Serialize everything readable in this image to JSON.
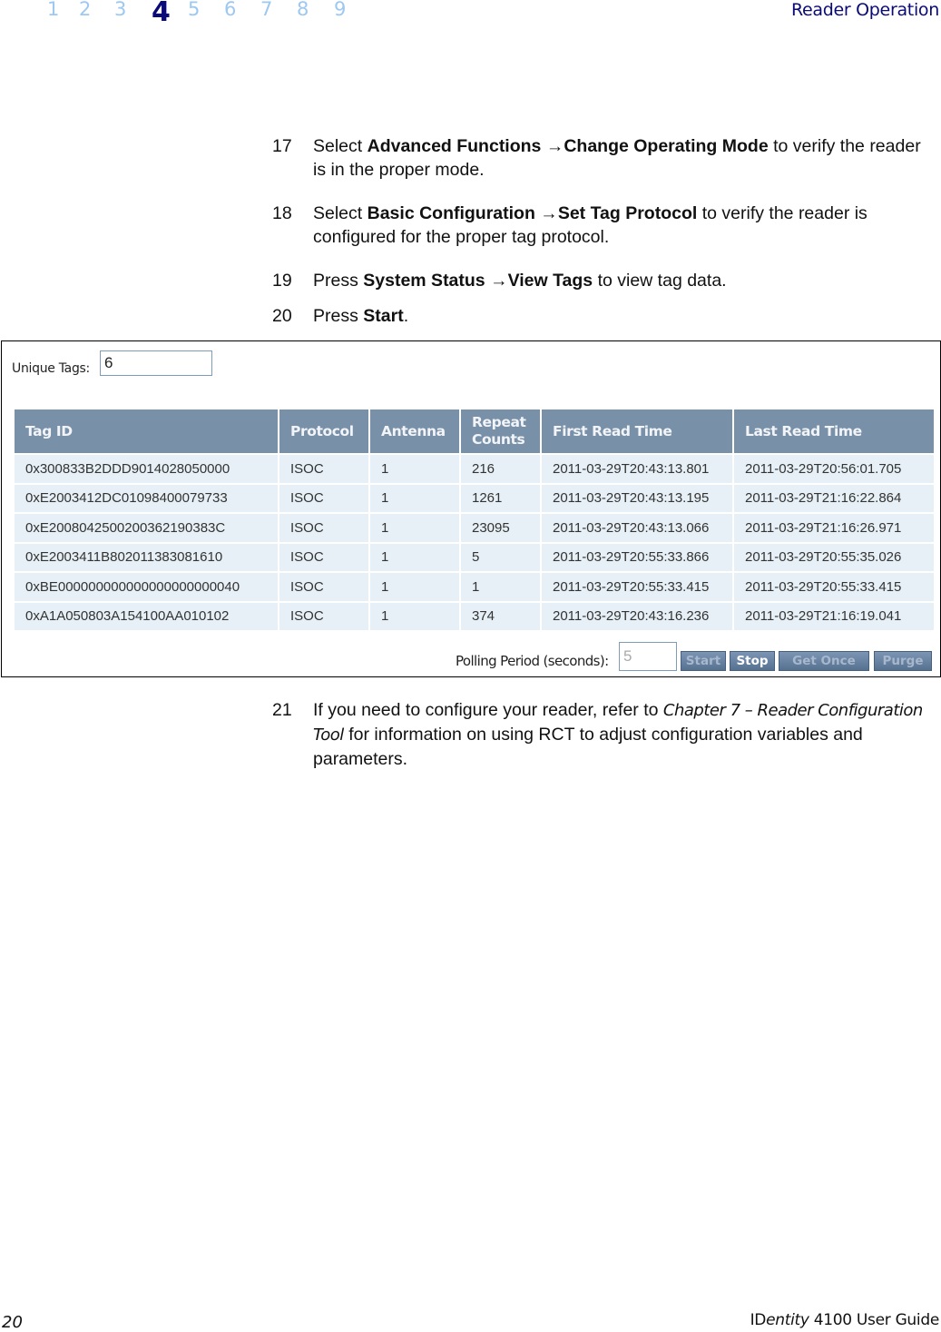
{
  "header": {
    "chapters": [
      "1",
      "2",
      "3",
      "4",
      "5",
      "6",
      "7",
      "8",
      "9"
    ],
    "current_chapter": "4",
    "section_title": "Reader Operation"
  },
  "steps": [
    {
      "number": "17",
      "text_before": "Select ",
      "bold1": "Advanced Functions",
      "arrow": " →",
      "bold2": "Change Operating Mode",
      "text_after": " to verify the reader is in the proper mode."
    },
    {
      "number": "18",
      "text_before": "Select ",
      "bold1": "Basic Configuration",
      "arrow": " →",
      "bold2": "Set Tag Protocol",
      "text_after": " to verify the reader is configured for the proper tag protocol."
    },
    {
      "number": "19",
      "text_before": "Press ",
      "bold1": "System Status",
      "arrow": " →",
      "bold2": "View Tags",
      "text_after": " to view tag data."
    },
    {
      "number": "20",
      "text_before": "Press ",
      "bold1": "Start",
      "text_after": "."
    },
    {
      "number": "21",
      "text_before": "If you need to configure your reader, refer to ",
      "italic": "Chapter 7 –  Reader Configuration Tool",
      "text_after": " for information on using RCT to adjust configuration variables and parameters."
    }
  ],
  "screenshot": {
    "unique_tags_label": "Unique Tags:",
    "unique_tags_value": "6",
    "columns": [
      "Tag ID",
      "Protocol",
      "Antenna",
      "Repeat Counts",
      "First Read Time",
      "Last Read Time"
    ],
    "rows": [
      [
        "0x300833B2DDD9014028050000",
        "ISOC",
        "1",
        "216",
        "2011-03-29T20:43:13.801",
        "2011-03-29T20:56:01.705"
      ],
      [
        "0xE2003412DC01098400079733",
        "ISOC",
        "1",
        "1261",
        "2011-03-29T20:43:13.195",
        "2011-03-29T21:16:22.864"
      ],
      [
        "0xE2008042500200362190383C",
        "ISOC",
        "1",
        "23095",
        "2011-03-29T20:43:13.066",
        "2011-03-29T21:16:26.971"
      ],
      [
        "0xE2003411B802011383081610",
        "ISOC",
        "1",
        "5",
        "2011-03-29T20:55:33.866",
        "2011-03-29T20:55:35.026"
      ],
      [
        "0xBE000000000000000000000040",
        "ISOC",
        "1",
        "1",
        "2011-03-29T20:55:33.415",
        "2011-03-29T20:55:33.415"
      ],
      [
        "0xA1A050803A154100AA010102",
        "ISOC",
        "1",
        "374",
        "2011-03-29T20:43:16.236",
        "2011-03-29T21:16:19.041"
      ]
    ],
    "polling_label": "Polling Period (seconds):",
    "polling_value": "5",
    "buttons": {
      "start": "Start",
      "stop": "Stop",
      "get_once": "Get Once",
      "purge": "Purge"
    }
  },
  "footer": {
    "page_number": "20",
    "guide_prefix": "ID",
    "guide_italic": "entity",
    "guide_suffix": " 4100 User Guide"
  }
}
